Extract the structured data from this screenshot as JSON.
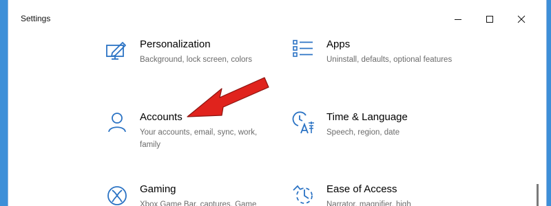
{
  "window": {
    "title": "Settings"
  },
  "titlebar": {
    "buttons": [
      "minimize-icon",
      "maximize-icon",
      "close-icon"
    ]
  },
  "colors": {
    "accent": "#2b73c4",
    "arrow": "#e0231d",
    "background": "#3d8fd8"
  },
  "tiles": [
    {
      "icon": "personalization-icon",
      "title": "Personalization",
      "description": "Background, lock screen, colors"
    },
    {
      "icon": "apps-icon",
      "title": "Apps",
      "description": "Uninstall, defaults, optional features"
    },
    {
      "icon": "accounts-icon",
      "title": "Accounts",
      "description": "Your accounts, email, sync, work, family"
    },
    {
      "icon": "time-language-icon",
      "title": "Time & Language",
      "description": "Speech, region, date"
    },
    {
      "icon": "gaming-icon",
      "title": "Gaming",
      "description": "Xbox Game Bar, captures, Game"
    },
    {
      "icon": "ease-of-access-icon",
      "title": "Ease of Access",
      "description": "Narrator, magnifier, high"
    }
  ],
  "annotation": {
    "icon": "red-arrow-annotation",
    "points_to": "Accounts"
  }
}
